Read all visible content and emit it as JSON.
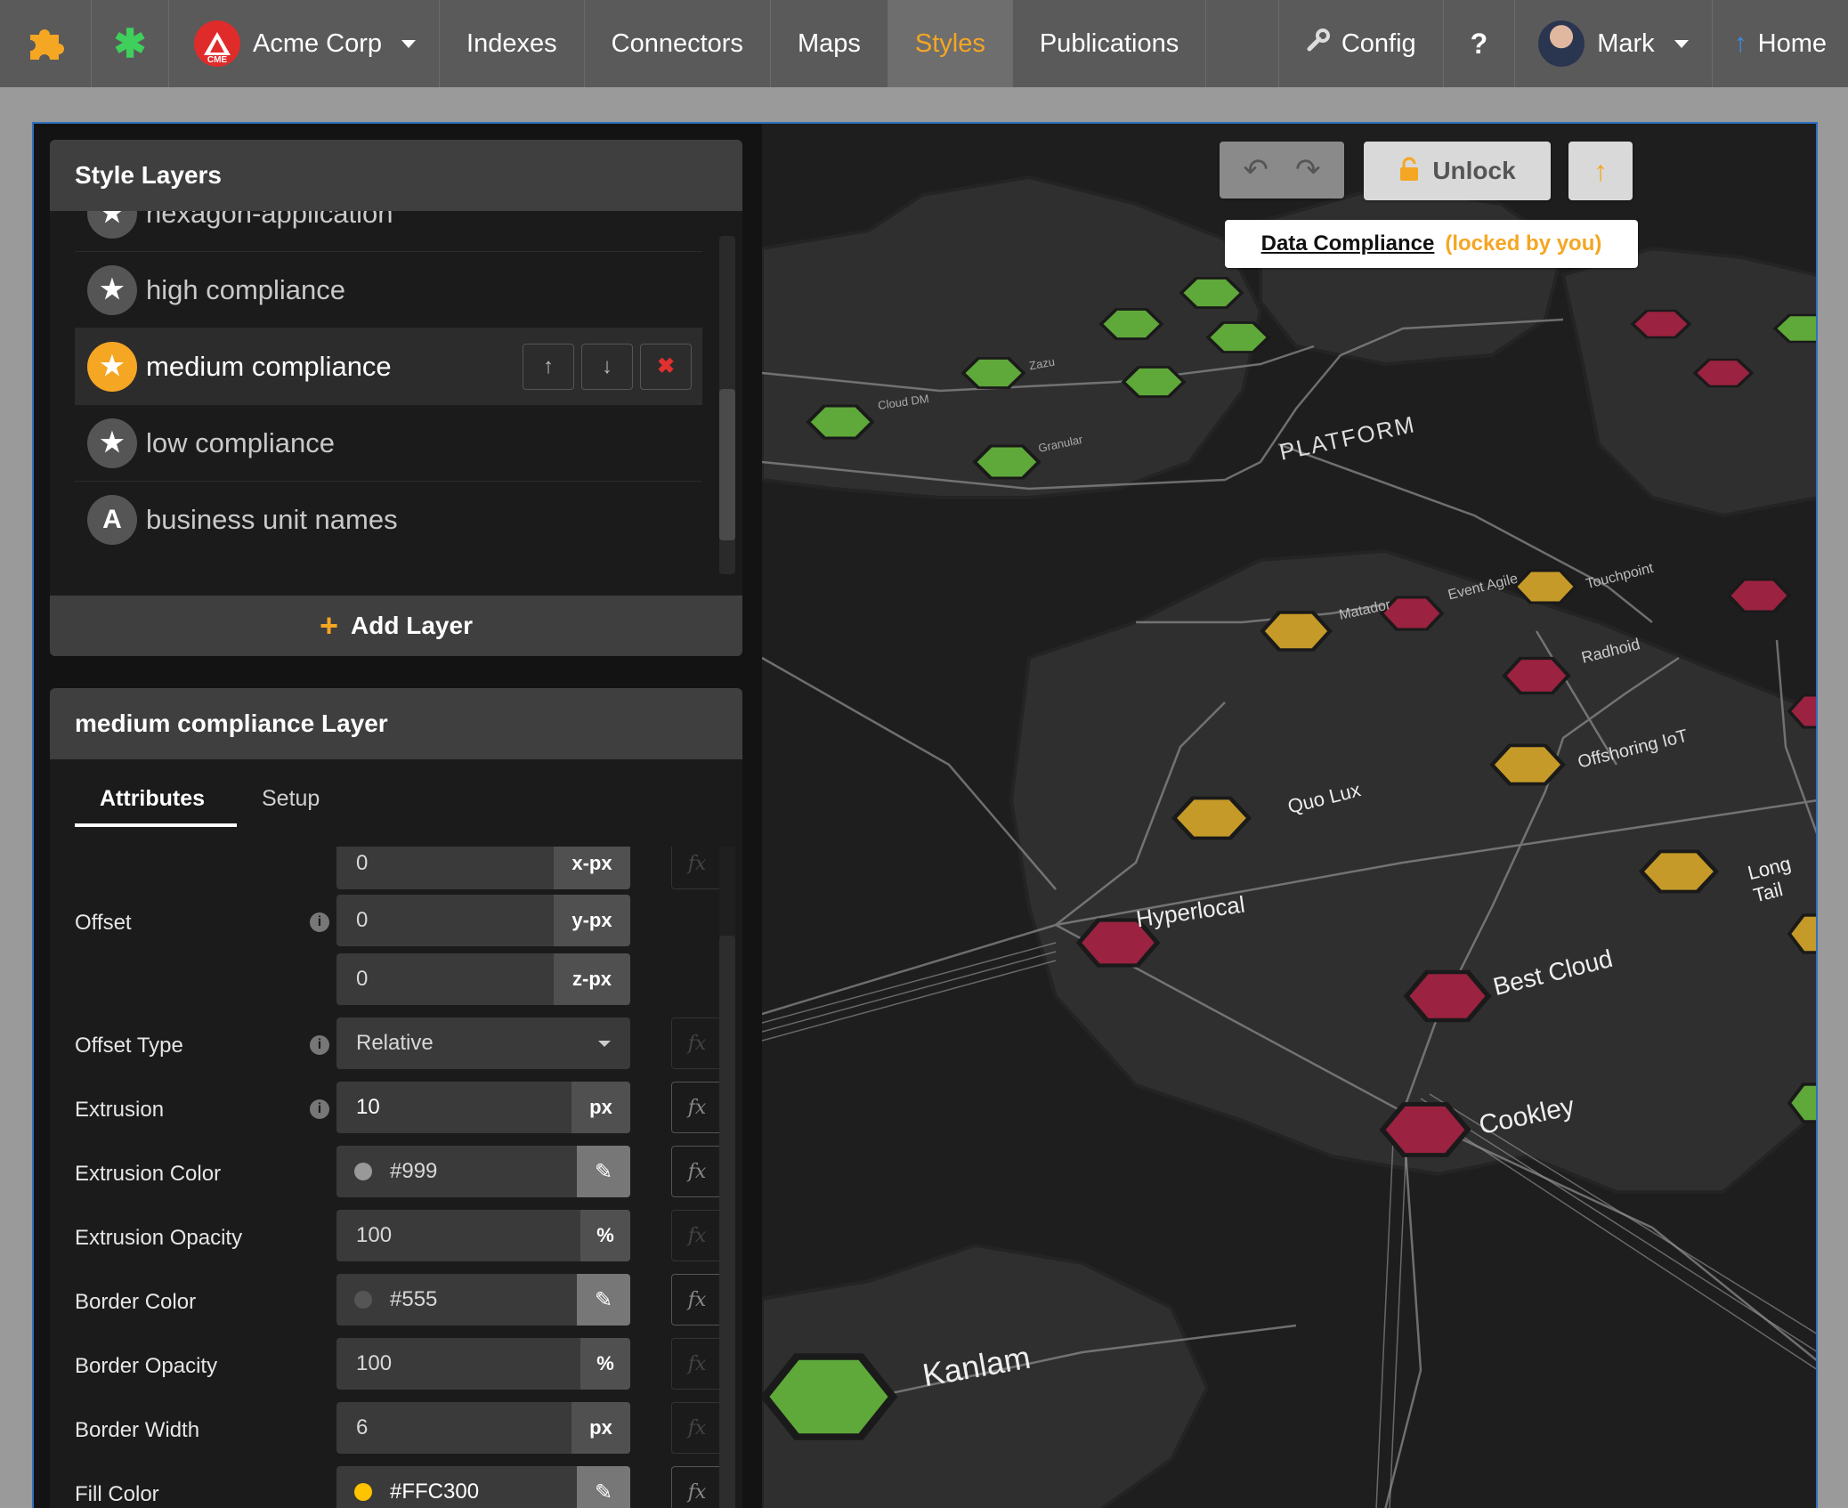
{
  "navbar": {
    "org_name": "Acme Corp",
    "org_logo_text": "CME",
    "items": [
      "Indexes",
      "Connectors",
      "Maps",
      "Styles",
      "Publications"
    ],
    "active_item": "Styles",
    "config_label": "Config",
    "help_label": "?",
    "user_name": "Mark",
    "home_label": "Home"
  },
  "style_layers": {
    "title": "Style Layers",
    "layers": [
      {
        "name": "hexagon-application",
        "icon": "star-icon"
      },
      {
        "name": "high compliance",
        "icon": "star-icon"
      },
      {
        "name": "medium compliance",
        "icon": "star-icon",
        "selected": true
      },
      {
        "name": "low compliance",
        "icon": "star-icon"
      },
      {
        "name": "business unit names",
        "icon_letter": "A"
      }
    ],
    "add_layer_label": "Add Layer"
  },
  "layer_editor": {
    "title": "medium compliance Layer",
    "tabs": [
      "Attributes",
      "Setup"
    ],
    "active_tab": "Attributes",
    "offset": {
      "label": "Offset",
      "x": "0",
      "x_unit": "x-px",
      "y": "0",
      "y_unit": "y-px",
      "z": "0",
      "z_unit": "z-px"
    },
    "offset_type": {
      "label": "Offset Type",
      "value": "Relative"
    },
    "extrusion": {
      "label": "Extrusion",
      "value": "10",
      "unit": "px"
    },
    "extrusion_color": {
      "label": "Extrusion Color",
      "value": "#999"
    },
    "extrusion_opacity": {
      "label": "Extrusion Opacity",
      "value": "100",
      "unit": "%"
    },
    "border_color": {
      "label": "Border Color",
      "value": "#555"
    },
    "border_opacity": {
      "label": "Border Opacity",
      "value": "100",
      "unit": "%"
    },
    "border_width": {
      "label": "Border Width",
      "value": "6",
      "unit": "px"
    },
    "fill_color": {
      "label": "Fill Color",
      "value": "#FFC300"
    },
    "fx_label": "fx"
  },
  "map_toolbar": {
    "unlock_label": "Unlock",
    "map_name": "Data Compliance",
    "lock_status": "(locked by you)"
  },
  "map_labels": {
    "platform": "PLATFORM",
    "hyperlocal": "Hyperlocal",
    "best_cloud": "Best Cloud",
    "cookley": "Cookley",
    "kanlam": "Kanlam",
    "quo_lux": "Quo Lux",
    "offshoring_iot": "Offshoring IoT",
    "radhoid": "Radhoid",
    "long_tail": "Long Tail",
    "touchpoint": "Touchpoint",
    "event_agile": "Event Agile",
    "matador": "Matador",
    "granular": "Granular",
    "cloud_dm": "Cloud DM",
    "zazu": "Zazu"
  },
  "colors": {
    "accent": "#f5a623",
    "high": "#5fa83a",
    "medium": "#c59a28",
    "low": "#9b2240",
    "lock": "#f5a623"
  }
}
